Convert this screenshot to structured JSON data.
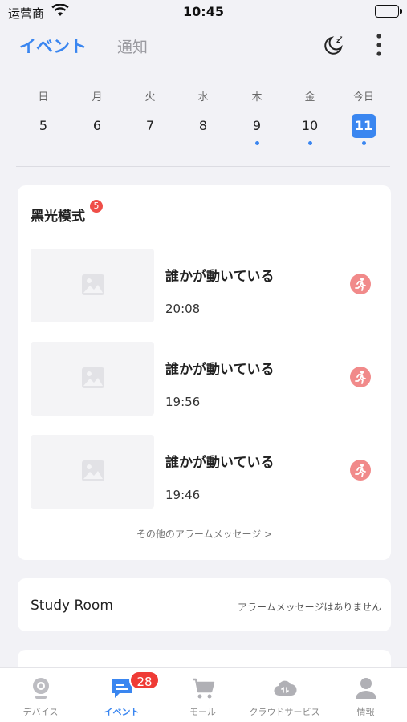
{
  "status": {
    "carrier": "运营商",
    "time": "10:45"
  },
  "header": {
    "active_tab": "イベント",
    "tab2": "通知",
    "moon_icon": "sleep-mode-icon",
    "more_icon": "more-vertical-icon"
  },
  "calendar": {
    "days": [
      {
        "weekday": "日",
        "date": "5",
        "has_event": false,
        "today": false
      },
      {
        "weekday": "月",
        "date": "6",
        "has_event": false,
        "today": false
      },
      {
        "weekday": "火",
        "date": "7",
        "has_event": false,
        "today": false
      },
      {
        "weekday": "水",
        "date": "8",
        "has_event": false,
        "today": false
      },
      {
        "weekday": "木",
        "date": "9",
        "has_event": true,
        "today": false
      },
      {
        "weekday": "金",
        "date": "10",
        "has_event": true,
        "today": false
      },
      {
        "weekday": "今日",
        "date": "11",
        "has_event": true,
        "today": true
      }
    ]
  },
  "camera1": {
    "name": "黑光模式",
    "badge": "5",
    "events": [
      {
        "title": "誰かが動いている",
        "time": "20:08"
      },
      {
        "title": "誰かが動いている",
        "time": "19:56"
      },
      {
        "title": "誰かが動いている",
        "time": "19:46"
      }
    ],
    "more_link": "その他のアラームメッセージ >"
  },
  "camera2": {
    "name": "Study Room",
    "empty": "アラームメッセージはありません"
  },
  "tabbar": {
    "items": [
      {
        "label": "デバイス",
        "icon": "camera-icon"
      },
      {
        "label": "イベント",
        "icon": "message-icon",
        "badge": "28"
      },
      {
        "label": "モール",
        "icon": "cart-icon"
      },
      {
        "label": "クラウドサービス",
        "icon": "cloud-icon"
      },
      {
        "label": "情報",
        "icon": "user-icon"
      }
    ]
  },
  "colors": {
    "accent": "#3a86f0",
    "alert": "#ef3b36",
    "motion": "#f18a8a"
  }
}
